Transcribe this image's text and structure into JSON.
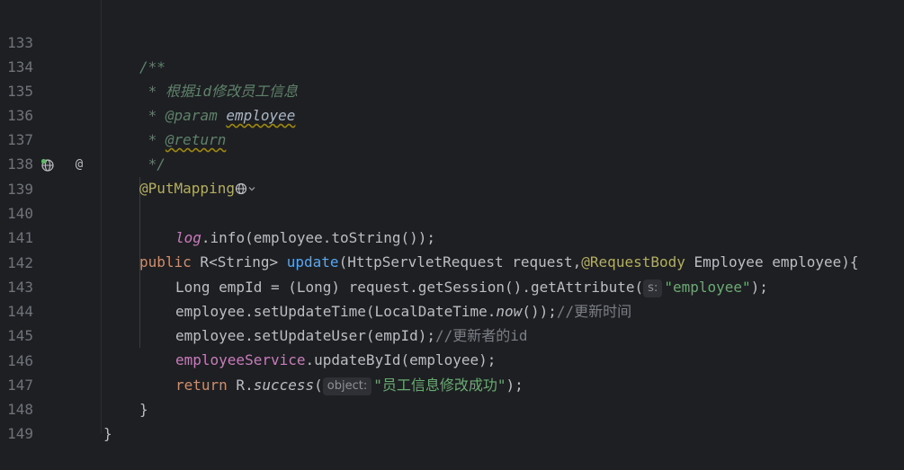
{
  "lines": [
    {
      "num": "133"
    },
    {
      "num": "134"
    },
    {
      "num": "135"
    },
    {
      "num": "136"
    },
    {
      "num": "137"
    },
    {
      "num": "138"
    },
    {
      "num": "139"
    },
    {
      "num": "140"
    },
    {
      "num": "141"
    },
    {
      "num": "142"
    },
    {
      "num": "143"
    },
    {
      "num": "144"
    },
    {
      "num": "145"
    },
    {
      "num": "146"
    },
    {
      "num": "147"
    },
    {
      "num": "148"
    },
    {
      "num": "149"
    }
  ],
  "code": {
    "l133": "/**",
    "l134_star": " * ",
    "l134_text": "根据id修改员工信息",
    "l135_star": " * ",
    "l135_tag": "@param",
    "l135_sp": " ",
    "l135_param": "employee",
    "l136_star": " * ",
    "l136_tag": "@return",
    "l137": " */",
    "l138_ann": "@PutMapping",
    "l139_public": "public",
    "l139_type": " R<String> ",
    "l139_fn": "update",
    "l139_args1": "(HttpServletRequest request,",
    "l139_ann": "@RequestBody",
    "l139_args2": " Employee employee){",
    "l140_log": "log",
    "l140_rest": ".info(employee.toString());",
    "l142_a": "Long empId = (Long) request.getSession().getAttribute(",
    "l142_hint": "s:",
    "l142_str": "\"employee\"",
    "l142_b": ");",
    "l143_a": "employee.setUpdateTime(LocalDateTime.",
    "l143_now": "now",
    "l143_b": "());",
    "l143_comment": "//更新时间",
    "l144_a": "employee.setUpdateUser(empId);",
    "l144_comment": "//更新者的id",
    "l145_field": "employeeService",
    "l145_rest": ".updateById(employee);",
    "l146_return": "return",
    "l146_a": " R.",
    "l146_success": "success",
    "l146_paren": "(",
    "l146_hint": "object:",
    "l146_str": "\"员工信息修改成功\"",
    "l146_b": ");",
    "l147": "}",
    "l148": "}"
  },
  "gutter_icons": {
    "line139_left": "web-endpoint-icon",
    "line139_right": "override-at-icon",
    "line139_right_glyph": "@"
  },
  "colors": {
    "background": "#1e1f22",
    "keyword": "#cf8e6d",
    "function": "#56a8f5",
    "annotation": "#b3ae60",
    "string": "#6aab73",
    "field": "#c77dbb",
    "doc": "#5f826b",
    "comment": "#7a7e85"
  }
}
